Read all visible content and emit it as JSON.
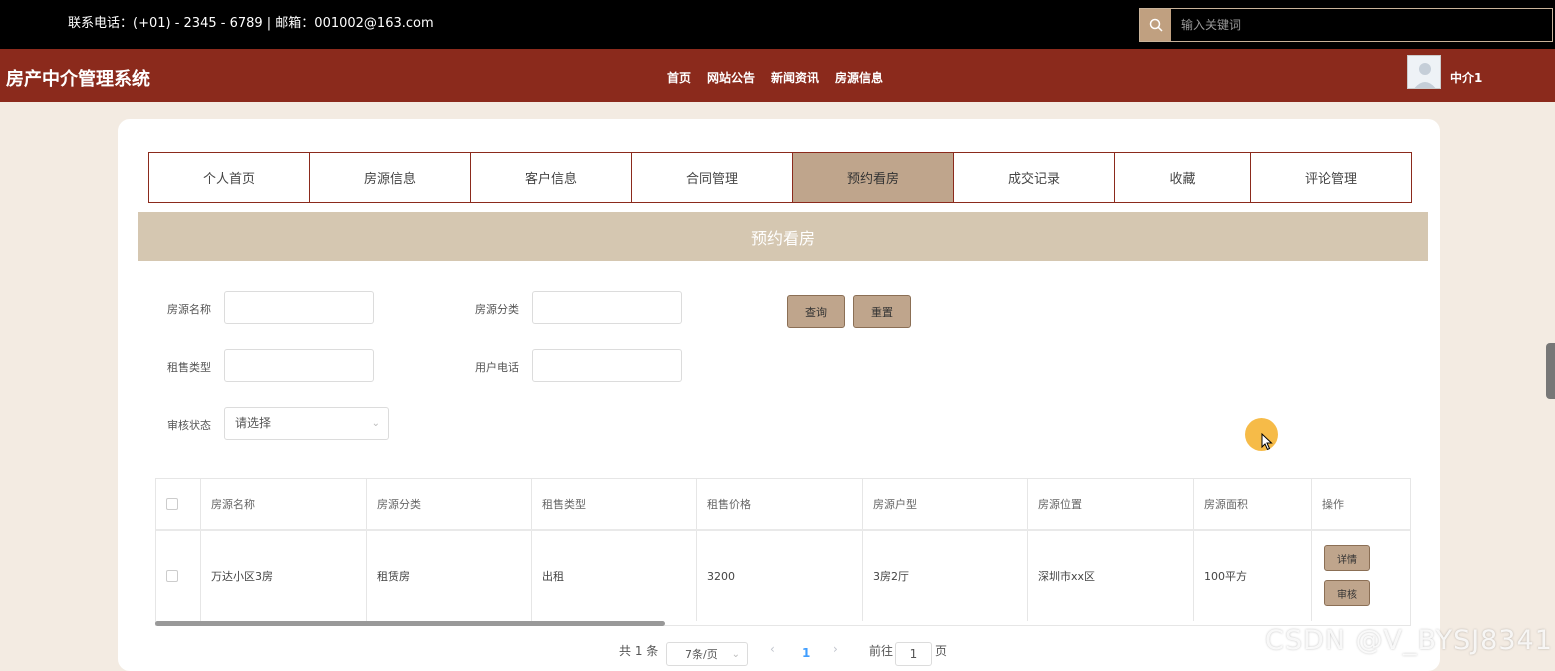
{
  "topbar": {
    "contact": "联系电话：(+01) - 2345 - 6789 | 邮箱：001002@163.com",
    "search_placeholder": "输入关键词"
  },
  "navbar": {
    "brand": "房产中介管理系统",
    "links": [
      "首页",
      "网站公告",
      "新闻资讯",
      "房源信息"
    ],
    "username": "中介1"
  },
  "tabs": [
    "个人首页",
    "房源信息",
    "客户信息",
    "合同管理",
    "预约看房",
    "成交记录",
    "收藏",
    "评论管理"
  ],
  "active_tab": "预约看房",
  "section_title": "预约看房",
  "filters": {
    "name_label": "房源名称",
    "category_label": "房源分类",
    "sale_type_label": "租售类型",
    "phone_label": "用户电话",
    "status_label": "审核状态",
    "status_placeholder": "请选择",
    "query_button": "查询",
    "reset_button": "重置"
  },
  "table": {
    "headers": [
      "房源名称",
      "房源分类",
      "租售类型",
      "租售价格",
      "房源户型",
      "房源位置",
      "房源面积",
      "操作"
    ],
    "rows": [
      {
        "name": "万达小区3房",
        "category": "租赁房",
        "sale_type": "出租",
        "price": "3200",
        "layout": "3房2厅",
        "location": "深圳市xx区",
        "area": "100平方",
        "detail_button": "详情",
        "review_button": "审核"
      }
    ]
  },
  "pagination": {
    "total": "共 1 条",
    "page_size": "7条/页",
    "current_page": "1",
    "goto_label": "前往",
    "goto_value": "1",
    "page_suffix": "页"
  },
  "watermark": "CSDN @V_BYSJ8341",
  "colors": {
    "topbar": "#000000",
    "navbar": "#8b2a1c",
    "accent": "#bfa58c",
    "section_title_bg": "#d5c7b1",
    "page_bg": "#f3ebe2"
  }
}
